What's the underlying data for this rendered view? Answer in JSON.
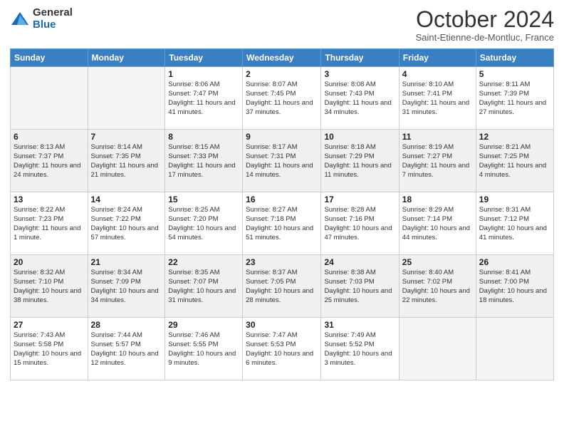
{
  "header": {
    "logo_general": "General",
    "logo_blue": "Blue",
    "month_title": "October 2024",
    "location": "Saint-Etienne-de-Montluc, France"
  },
  "days_of_week": [
    "Sunday",
    "Monday",
    "Tuesday",
    "Wednesday",
    "Thursday",
    "Friday",
    "Saturday"
  ],
  "weeks": [
    [
      {
        "day": "",
        "info": ""
      },
      {
        "day": "",
        "info": ""
      },
      {
        "day": "1",
        "info": "Sunrise: 8:06 AM\nSunset: 7:47 PM\nDaylight: 11 hours and 41 minutes."
      },
      {
        "day": "2",
        "info": "Sunrise: 8:07 AM\nSunset: 7:45 PM\nDaylight: 11 hours and 37 minutes."
      },
      {
        "day": "3",
        "info": "Sunrise: 8:08 AM\nSunset: 7:43 PM\nDaylight: 11 hours and 34 minutes."
      },
      {
        "day": "4",
        "info": "Sunrise: 8:10 AM\nSunset: 7:41 PM\nDaylight: 11 hours and 31 minutes."
      },
      {
        "day": "5",
        "info": "Sunrise: 8:11 AM\nSunset: 7:39 PM\nDaylight: 11 hours and 27 minutes."
      }
    ],
    [
      {
        "day": "6",
        "info": "Sunrise: 8:13 AM\nSunset: 7:37 PM\nDaylight: 11 hours and 24 minutes."
      },
      {
        "day": "7",
        "info": "Sunrise: 8:14 AM\nSunset: 7:35 PM\nDaylight: 11 hours and 21 minutes."
      },
      {
        "day": "8",
        "info": "Sunrise: 8:15 AM\nSunset: 7:33 PM\nDaylight: 11 hours and 17 minutes."
      },
      {
        "day": "9",
        "info": "Sunrise: 8:17 AM\nSunset: 7:31 PM\nDaylight: 11 hours and 14 minutes."
      },
      {
        "day": "10",
        "info": "Sunrise: 8:18 AM\nSunset: 7:29 PM\nDaylight: 11 hours and 11 minutes."
      },
      {
        "day": "11",
        "info": "Sunrise: 8:19 AM\nSunset: 7:27 PM\nDaylight: 11 hours and 7 minutes."
      },
      {
        "day": "12",
        "info": "Sunrise: 8:21 AM\nSunset: 7:25 PM\nDaylight: 11 hours and 4 minutes."
      }
    ],
    [
      {
        "day": "13",
        "info": "Sunrise: 8:22 AM\nSunset: 7:23 PM\nDaylight: 11 hours and 1 minute."
      },
      {
        "day": "14",
        "info": "Sunrise: 8:24 AM\nSunset: 7:22 PM\nDaylight: 10 hours and 57 minutes."
      },
      {
        "day": "15",
        "info": "Sunrise: 8:25 AM\nSunset: 7:20 PM\nDaylight: 10 hours and 54 minutes."
      },
      {
        "day": "16",
        "info": "Sunrise: 8:27 AM\nSunset: 7:18 PM\nDaylight: 10 hours and 51 minutes."
      },
      {
        "day": "17",
        "info": "Sunrise: 8:28 AM\nSunset: 7:16 PM\nDaylight: 10 hours and 47 minutes."
      },
      {
        "day": "18",
        "info": "Sunrise: 8:29 AM\nSunset: 7:14 PM\nDaylight: 10 hours and 44 minutes."
      },
      {
        "day": "19",
        "info": "Sunrise: 8:31 AM\nSunset: 7:12 PM\nDaylight: 10 hours and 41 minutes."
      }
    ],
    [
      {
        "day": "20",
        "info": "Sunrise: 8:32 AM\nSunset: 7:10 PM\nDaylight: 10 hours and 38 minutes."
      },
      {
        "day": "21",
        "info": "Sunrise: 8:34 AM\nSunset: 7:09 PM\nDaylight: 10 hours and 34 minutes."
      },
      {
        "day": "22",
        "info": "Sunrise: 8:35 AM\nSunset: 7:07 PM\nDaylight: 10 hours and 31 minutes."
      },
      {
        "day": "23",
        "info": "Sunrise: 8:37 AM\nSunset: 7:05 PM\nDaylight: 10 hours and 28 minutes."
      },
      {
        "day": "24",
        "info": "Sunrise: 8:38 AM\nSunset: 7:03 PM\nDaylight: 10 hours and 25 minutes."
      },
      {
        "day": "25",
        "info": "Sunrise: 8:40 AM\nSunset: 7:02 PM\nDaylight: 10 hours and 22 minutes."
      },
      {
        "day": "26",
        "info": "Sunrise: 8:41 AM\nSunset: 7:00 PM\nDaylight: 10 hours and 18 minutes."
      }
    ],
    [
      {
        "day": "27",
        "info": "Sunrise: 7:43 AM\nSunset: 5:58 PM\nDaylight: 10 hours and 15 minutes."
      },
      {
        "day": "28",
        "info": "Sunrise: 7:44 AM\nSunset: 5:57 PM\nDaylight: 10 hours and 12 minutes."
      },
      {
        "day": "29",
        "info": "Sunrise: 7:46 AM\nSunset: 5:55 PM\nDaylight: 10 hours and 9 minutes."
      },
      {
        "day": "30",
        "info": "Sunrise: 7:47 AM\nSunset: 5:53 PM\nDaylight: 10 hours and 6 minutes."
      },
      {
        "day": "31",
        "info": "Sunrise: 7:49 AM\nSunset: 5:52 PM\nDaylight: 10 hours and 3 minutes."
      },
      {
        "day": "",
        "info": ""
      },
      {
        "day": "",
        "info": ""
      }
    ]
  ]
}
